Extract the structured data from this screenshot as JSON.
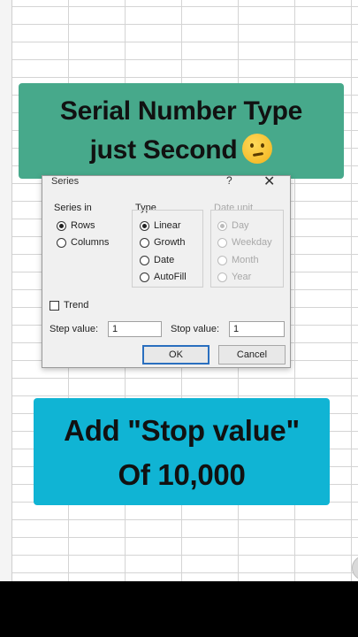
{
  "banner_top": {
    "line1": "Serial Number Type",
    "line2": "just Second",
    "emoji": "thinking-face-emoji"
  },
  "banner_bottom": {
    "line1": "Add \"Stop value\"",
    "line2": "Of 10,000"
  },
  "dialog": {
    "title": "Series",
    "help": "?",
    "close": "✕",
    "series_in": {
      "label": "Series in",
      "options": [
        {
          "label": "Rows",
          "selected": true
        },
        {
          "label": "Columns",
          "selected": false
        }
      ]
    },
    "type": {
      "label": "Type",
      "options": [
        {
          "label": "Linear",
          "selected": true
        },
        {
          "label": "Growth",
          "selected": false
        },
        {
          "label": "Date",
          "selected": false
        },
        {
          "label": "AutoFill",
          "selected": false
        }
      ]
    },
    "date_unit": {
      "label": "Date unit",
      "options": [
        {
          "label": "Day",
          "selected": true
        },
        {
          "label": "Weekday",
          "selected": false
        },
        {
          "label": "Month",
          "selected": false
        },
        {
          "label": "Year",
          "selected": false
        }
      ]
    },
    "trend": {
      "label": "Trend",
      "checked": false
    },
    "step_value": {
      "label": "Step value:",
      "value": "1"
    },
    "stop_value": {
      "label": "Stop value:",
      "value": "1"
    },
    "ok_label": "OK",
    "cancel_label": "Cancel"
  }
}
